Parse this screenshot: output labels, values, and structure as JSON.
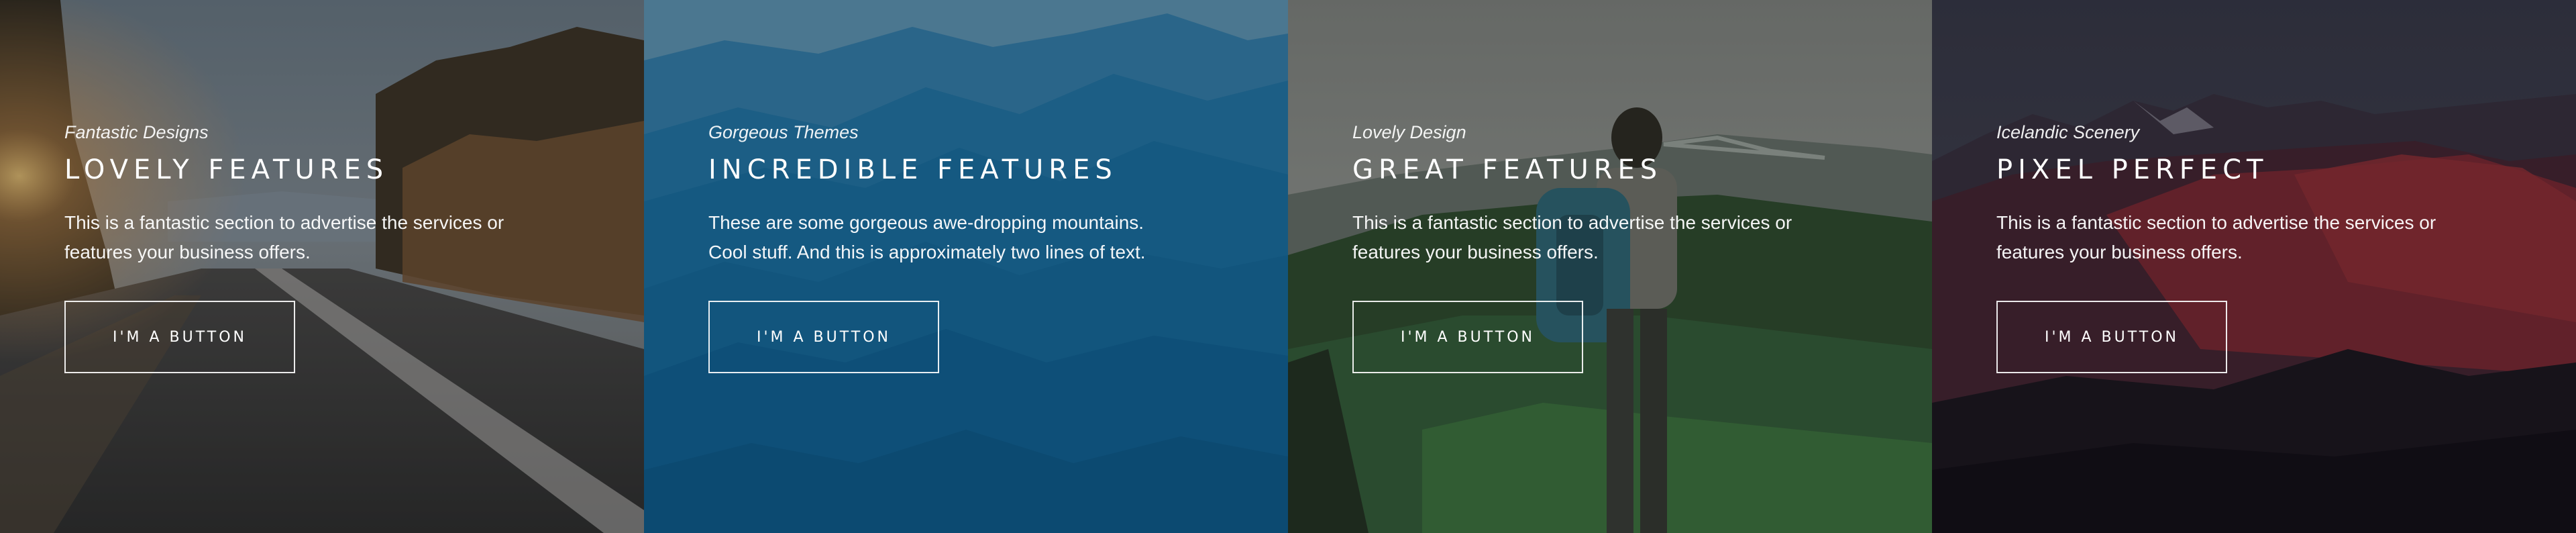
{
  "panels": [
    {
      "subtitle": "Fantastic Designs",
      "title": "LOVELY FEATURES",
      "description": "This is a fantastic section to advertise the services or features your business offers.",
      "button_label": "I'M A BUTTON"
    },
    {
      "subtitle": "Gorgeous Themes",
      "title": "INCREDIBLE FEATURES",
      "description": "These are some gorgeous awe-dropping mountains. Cool stuff. And this is approximately two lines of text.",
      "button_label": "I'M A BUTTON"
    },
    {
      "subtitle": "Lovely Design",
      "title": "GREAT FEATURES",
      "description": "This is a fantastic section to advertise the services or features your business offers.",
      "button_label": "I'M A BUTTON"
    },
    {
      "subtitle": "Icelandic Scenery",
      "title": "PIXEL PERFECT",
      "description": "This is a fantastic section to advertise the services or features your business offers.",
      "button_label": "I'M A BUTTON"
    }
  ],
  "colors": {
    "panel1_tint": "#3a3f45",
    "panel2_tint": "#0f5a80",
    "panel3_tint": "#2f4a32",
    "panel4_tint": "#1c1a26",
    "text": "#ffffff"
  }
}
